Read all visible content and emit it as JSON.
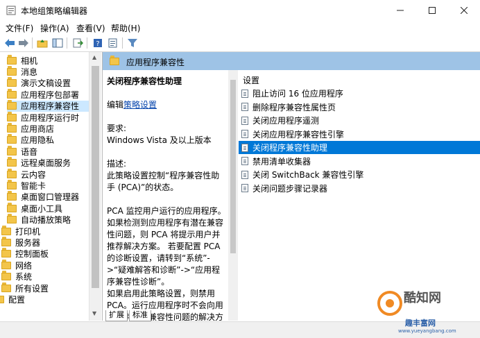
{
  "window": {
    "title": "本地组策略编辑器"
  },
  "menu": [
    "文件(F)",
    "操作(A)",
    "查看(V)",
    "帮助(H)"
  ],
  "tree": {
    "items": [
      {
        "label": "相机",
        "indent": 1
      },
      {
        "label": "消息",
        "indent": 1
      },
      {
        "label": "演示文稿设置",
        "indent": 1
      },
      {
        "label": "应用程序包部署",
        "indent": 1
      },
      {
        "label": "应用程序兼容性",
        "indent": 1,
        "selected": true
      },
      {
        "label": "应用程序运行时",
        "indent": 1
      },
      {
        "label": "应用商店",
        "indent": 1
      },
      {
        "label": "应用隐私",
        "indent": 1
      },
      {
        "label": "语音",
        "indent": 1
      },
      {
        "label": "远程桌面服务",
        "indent": 1
      },
      {
        "label": "云内容",
        "indent": 1
      },
      {
        "label": "智能卡",
        "indent": 1
      },
      {
        "label": "桌面窗口管理器",
        "indent": 1
      },
      {
        "label": "桌面小工具",
        "indent": 1
      },
      {
        "label": "自动播放策略",
        "indent": 1
      },
      {
        "label": "打印机",
        "indent": 0
      },
      {
        "label": "服务器",
        "indent": 0
      },
      {
        "label": "控制面板",
        "indent": 0
      },
      {
        "label": "网络",
        "indent": 0
      },
      {
        "label": "系统",
        "indent": 0
      },
      {
        "label": "所有设置",
        "indent": 0
      },
      {
        "label": "配置",
        "indent": -1
      }
    ]
  },
  "section": {
    "title": "应用程序兼容性"
  },
  "description": {
    "heading": "关闭程序兼容性助理",
    "edit_prefix": "编辑",
    "edit_link": "策略设置",
    "req_label": "要求:",
    "req_value": "Windows Vista 及以上版本",
    "desc_label": "描述:",
    "desc_1": "此策略设置控制“程序兼容性助手 (PCA)”的状态。",
    "desc_2": "PCA 监控用户运行的应用程序。如果检测到应用程序有潜在兼容性问题，则 PCA 将提示用户并推荐解决方案。 若要配置 PCA 的诊断设置，请转到“系统”->“疑难解答和诊断”->“应用程序兼容性诊断”。",
    "desc_3": "如果启用此策略设置，则禁用 PCA。运行应用程序时不会向用户提供已知兼容性问题的解决方案。"
  },
  "list": {
    "header": "设置",
    "rows": [
      {
        "label": "阻止访问 16 位应用程序"
      },
      {
        "label": "删除程序兼容性属性页"
      },
      {
        "label": "关闭应用程序遥测"
      },
      {
        "label": "关闭应用程序兼容性引擎"
      },
      {
        "label": "关闭程序兼容性助理",
        "selected": true
      },
      {
        "label": "禁用清单收集器"
      },
      {
        "label": "关闭 SwitchBack 兼容性引擎"
      },
      {
        "label": "关闭问题步骤记录器"
      }
    ]
  },
  "tabs": [
    "扩展",
    "标准"
  ],
  "watermark": {
    "brand": "酷知网",
    "site": "趣丰富网",
    "url": "www.yueyangbang.com"
  },
  "colors": {
    "selection": "#0078d7",
    "tree_selection": "#cce8ff",
    "header": "#9ec3e6",
    "folder": "#f3c54a"
  }
}
